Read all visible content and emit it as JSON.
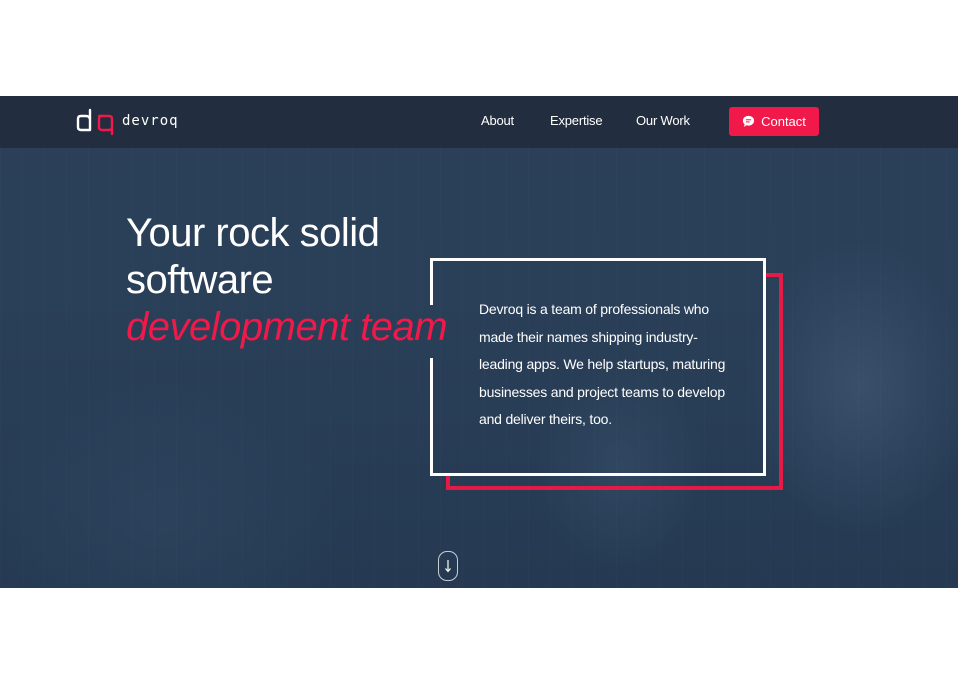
{
  "brand": {
    "name": "devroq",
    "logo_icon": "dq-logo-icon",
    "accent_color": "#f0194a"
  },
  "nav": {
    "items": [
      {
        "label": "About"
      },
      {
        "label": "Expertise"
      },
      {
        "label": "Our Work"
      }
    ],
    "contact": {
      "label": "Contact",
      "icon": "chat-bubble-icon"
    }
  },
  "hero": {
    "headline_line1": "Your rock solid",
    "headline_line2": "software",
    "headline_accent": "development team",
    "description": "Devroq is a team of professionals who made their names shipping industry-leading apps. We help startups, maturing businesses and project teams to develop and deliver theirs, too.",
    "scroll_icon": "arrow-down-icon"
  }
}
